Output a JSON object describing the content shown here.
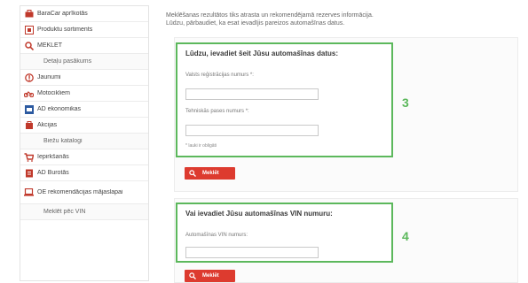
{
  "sidebar": {
    "items": [
      {
        "label": "BaraCar aprīkotās",
        "icon": "shop-icon",
        "color": "#c0392b",
        "sub": false
      },
      {
        "label": "Produktu sortiments",
        "icon": "catalog-icon",
        "color": "#c0392b",
        "sub": false
      },
      {
        "label": "MEKLĒT",
        "icon": "search-icon",
        "color": "#c0392b",
        "sub": false
      },
      {
        "label": "Detaļu pasākums",
        "icon": "",
        "color": "",
        "sub": true
      },
      {
        "label": "Jaunumi",
        "icon": "info-icon",
        "color": "#c0392b",
        "sub": false
      },
      {
        "label": "Motocikliem",
        "icon": "motorcycle-icon",
        "color": "#c0392b",
        "sub": false
      },
      {
        "label": "AD ekonomikas",
        "icon": "badge-icon",
        "color": "#2c5aa0",
        "sub": false
      },
      {
        "label": "Akcijas",
        "icon": "tag-icon",
        "color": "#c0392b",
        "sub": false
      },
      {
        "label": "Biežu katalogi",
        "icon": "",
        "color": "",
        "sub": true
      },
      {
        "label": "Iepirkšanās",
        "icon": "cart-icon",
        "color": "#c0392b",
        "sub": false
      },
      {
        "label": "AD Burotās",
        "icon": "doc-icon",
        "color": "#c0392b",
        "sub": false
      },
      {
        "label": "OE rekomendācijas mājaslapai",
        "icon": "laptop-icon",
        "color": "#c0392b",
        "sub": false,
        "tall": true
      },
      {
        "label": "Meklēt pēc VIN",
        "icon": "",
        "color": "",
        "sub": true
      }
    ]
  },
  "intro": {
    "line1": "Meklēšanas rezultātos tiks atrasta un rekomendējamā rezerves informācija.",
    "line2": "Lūdzu, pārbaudiet, ka esat ievadījis pareizos automašīnas datus."
  },
  "form1": {
    "title": "Lūdzu, ievadiet šeit Jūsu automašīnas datus:",
    "reg_label": "Valsts reģistrācijas numurs *:",
    "reg_value": "",
    "cert_label": "Tehniskās pases numurs *:",
    "cert_value": "",
    "hint": "* lauki ir obligāti",
    "callout": "3",
    "search_label": "Meklēt"
  },
  "form2": {
    "title": "Vai ievadiet Jūsu automašīnas VIN numuru:",
    "vin_label": "Automašīnas VIN numurs:",
    "vin_value": "",
    "callout": "4",
    "search_label": "Meklēt"
  },
  "colors": {
    "accent_green": "#5cb85c",
    "button_red": "#dd3b2f"
  }
}
